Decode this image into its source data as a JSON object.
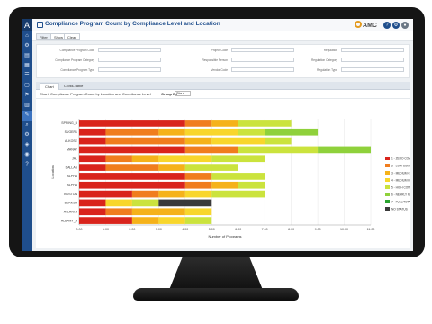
{
  "app": {
    "title": "Compliance Program Count by Compliance Level and Location",
    "brand": "AMC",
    "sidebar_icons": [
      "logo-icon",
      "home-icon",
      "settings-icon",
      "document-icon",
      "chart-icon",
      "list-icon",
      "folder-icon",
      "flag-icon",
      "report-icon",
      "tool-icon",
      "search-icon",
      "gear-icon",
      "shield-icon",
      "user-icon",
      "help-icon"
    ]
  },
  "toolbar": {
    "buttons": [
      "Filter",
      "Show",
      "Clear"
    ]
  },
  "filters": {
    "left": [
      "Compliance Program Code",
      "Compliance Program Category",
      "Compliance Program Type"
    ],
    "middle": [
      "Project Code",
      "Responsible Person",
      "Vendor Code"
    ],
    "right": [
      "Regulation",
      "Regulation Category",
      "Regulation Type"
    ]
  },
  "tabs": [
    "Chart",
    "Cross-Table"
  ],
  "chart_header": {
    "label": "Chart: Compliance Program Count by Location and Compliance Level",
    "group_by_label": "Group By",
    "group_by_value": "Site"
  },
  "chart_data": {
    "type": "bar",
    "orientation": "horizontal",
    "stacked": true,
    "xlabel": "Number of Programs",
    "ylabel": "Location",
    "xlim": [
      0,
      11
    ],
    "xticks": [
      "0.00",
      "1.00",
      "2.00",
      "3.00",
      "4.00",
      "5.00",
      "6.00",
      "7.00",
      "8.00",
      "9.00",
      "10.00",
      "11.00"
    ],
    "categories": [
      "SPRING_B",
      "SUGER1",
      "ALKOSE",
      "MANAT",
      "JAL",
      "DALLAS",
      "ALPHA",
      "ALPHA",
      "BOSTON",
      "BERKSH",
      "ATLANTA",
      "ALBANY_A"
    ],
    "series": [
      {
        "name": "1 - ZERO COMPLIANCE",
        "color": "#d9241c",
        "values": [
          4,
          1,
          1,
          4,
          1,
          1,
          4,
          4,
          2,
          1,
          1,
          2
        ]
      },
      {
        "name": "2 - LOW COMPLIANCE",
        "color": "#f07d1e",
        "values": [
          1,
          2,
          3,
          2,
          1,
          2,
          1,
          1,
          1,
          0,
          1,
          0
        ]
      },
      {
        "name": "3 - MEDIUM COMPLIANCE",
        "color": "#f5b21a",
        "values": [
          1,
          1,
          1,
          0,
          1,
          1,
          0,
          1,
          1,
          0,
          2,
          1
        ]
      },
      {
        "name": "4 - MEDIUM HIGH COMPLIANCE",
        "color": "#f8d62c",
        "values": [
          0,
          2,
          2,
          0,
          2,
          0,
          0,
          0,
          1,
          1,
          1,
          1
        ]
      },
      {
        "name": "5 - HIGH COMPLIANCE",
        "color": "#cbe33d",
        "values": [
          2,
          1,
          1,
          3,
          2,
          2,
          2,
          1,
          2,
          1,
          0,
          1
        ]
      },
      {
        "name": "6 - NEARLY FULL COMPLIANCE",
        "color": "#8fd13b",
        "values": [
          0,
          2,
          0,
          2,
          0,
          0,
          0,
          0,
          0,
          0,
          0,
          0
        ]
      },
      {
        "name": "7 - FULL/TOTAL COMPLIANCE",
        "color": "#2aa32f",
        "values": [
          0,
          0,
          0,
          0,
          0,
          0,
          0,
          0,
          0,
          0,
          0,
          0
        ]
      },
      {
        "name": "NO STATUS",
        "color": "#3a3a3a",
        "values": [
          0,
          0,
          0,
          0,
          0,
          0,
          0,
          0,
          0,
          2,
          0,
          0
        ]
      }
    ]
  }
}
